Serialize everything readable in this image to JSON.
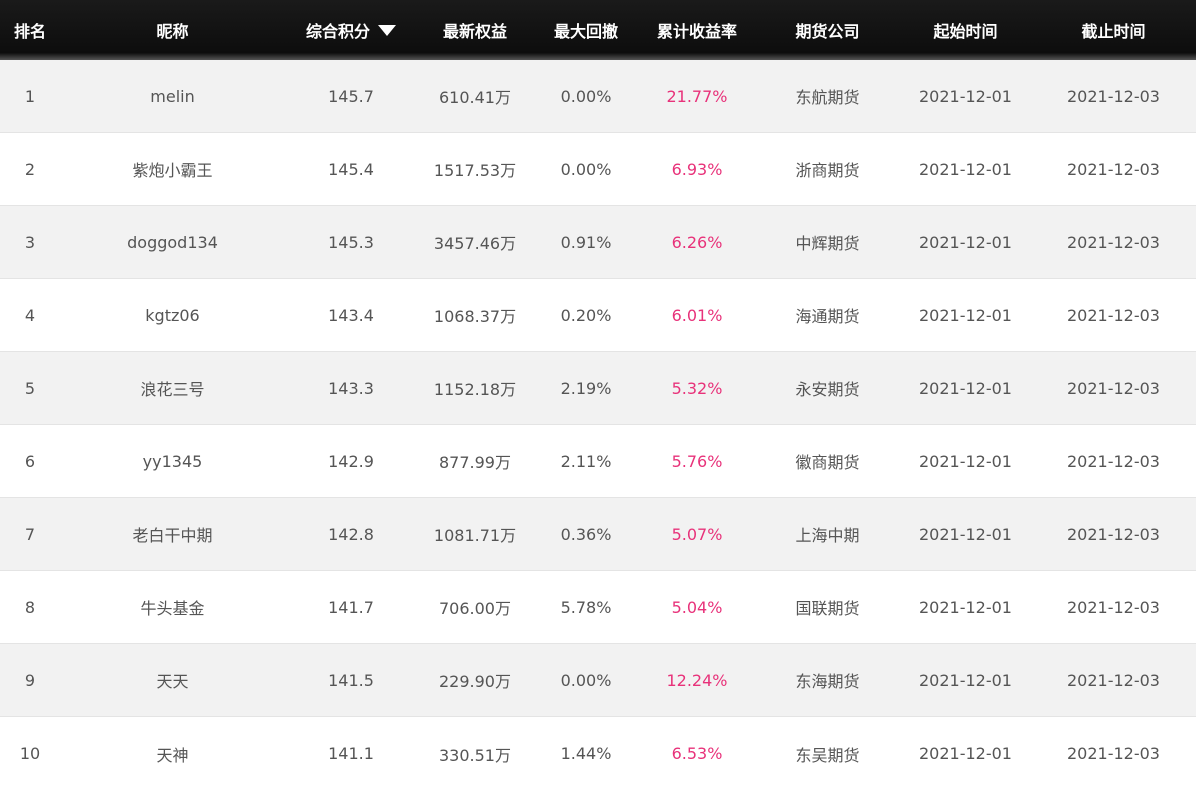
{
  "table": {
    "headers": {
      "rank": "排名",
      "nickname": "昵称",
      "score": "综合积分",
      "equity": "最新权益",
      "drawdown": "最大回撤",
      "return": "累计收益率",
      "company": "期货公司",
      "start": "起始时间",
      "end": "截止时间"
    },
    "sort_icon": "sort-down-icon",
    "accent_color": "#e8327a",
    "rows": [
      {
        "rank": "1",
        "nickname": "melin",
        "score": "145.7",
        "equity": "610.41万",
        "drawdown": "0.00%",
        "return": "21.77%",
        "company": "东航期货",
        "start": "2021-12-01",
        "end": "2021-12-03"
      },
      {
        "rank": "2",
        "nickname": "紫炮小霸王",
        "score": "145.4",
        "equity": "1517.53万",
        "drawdown": "0.00%",
        "return": "6.93%",
        "company": "浙商期货",
        "start": "2021-12-01",
        "end": "2021-12-03"
      },
      {
        "rank": "3",
        "nickname": "doggod134",
        "score": "145.3",
        "equity": "3457.46万",
        "drawdown": "0.91%",
        "return": "6.26%",
        "company": "中辉期货",
        "start": "2021-12-01",
        "end": "2021-12-03"
      },
      {
        "rank": "4",
        "nickname": "kgtz06",
        "score": "143.4",
        "equity": "1068.37万",
        "drawdown": "0.20%",
        "return": "6.01%",
        "company": "海通期货",
        "start": "2021-12-01",
        "end": "2021-12-03"
      },
      {
        "rank": "5",
        "nickname": "浪花三号",
        "score": "143.3",
        "equity": "1152.18万",
        "drawdown": "2.19%",
        "return": "5.32%",
        "company": "永安期货",
        "start": "2021-12-01",
        "end": "2021-12-03"
      },
      {
        "rank": "6",
        "nickname": "yy1345",
        "score": "142.9",
        "equity": "877.99万",
        "drawdown": "2.11%",
        "return": "5.76%",
        "company": "徽商期货",
        "start": "2021-12-01",
        "end": "2021-12-03"
      },
      {
        "rank": "7",
        "nickname": "老白干中期",
        "score": "142.8",
        "equity": "1081.71万",
        "drawdown": "0.36%",
        "return": "5.07%",
        "company": "上海中期",
        "start": "2021-12-01",
        "end": "2021-12-03"
      },
      {
        "rank": "8",
        "nickname": "牛头基金",
        "score": "141.7",
        "equity": "706.00万",
        "drawdown": "5.78%",
        "return": "5.04%",
        "company": "国联期货",
        "start": "2021-12-01",
        "end": "2021-12-03"
      },
      {
        "rank": "9",
        "nickname": "天天",
        "score": "141.5",
        "equity": "229.90万",
        "drawdown": "0.00%",
        "return": "12.24%",
        "company": "东海期货",
        "start": "2021-12-01",
        "end": "2021-12-03"
      },
      {
        "rank": "10",
        "nickname": "天神",
        "score": "141.1",
        "equity": "330.51万",
        "drawdown": "1.44%",
        "return": "6.53%",
        "company": "东吴期货",
        "start": "2021-12-01",
        "end": "2021-12-03"
      }
    ]
  }
}
